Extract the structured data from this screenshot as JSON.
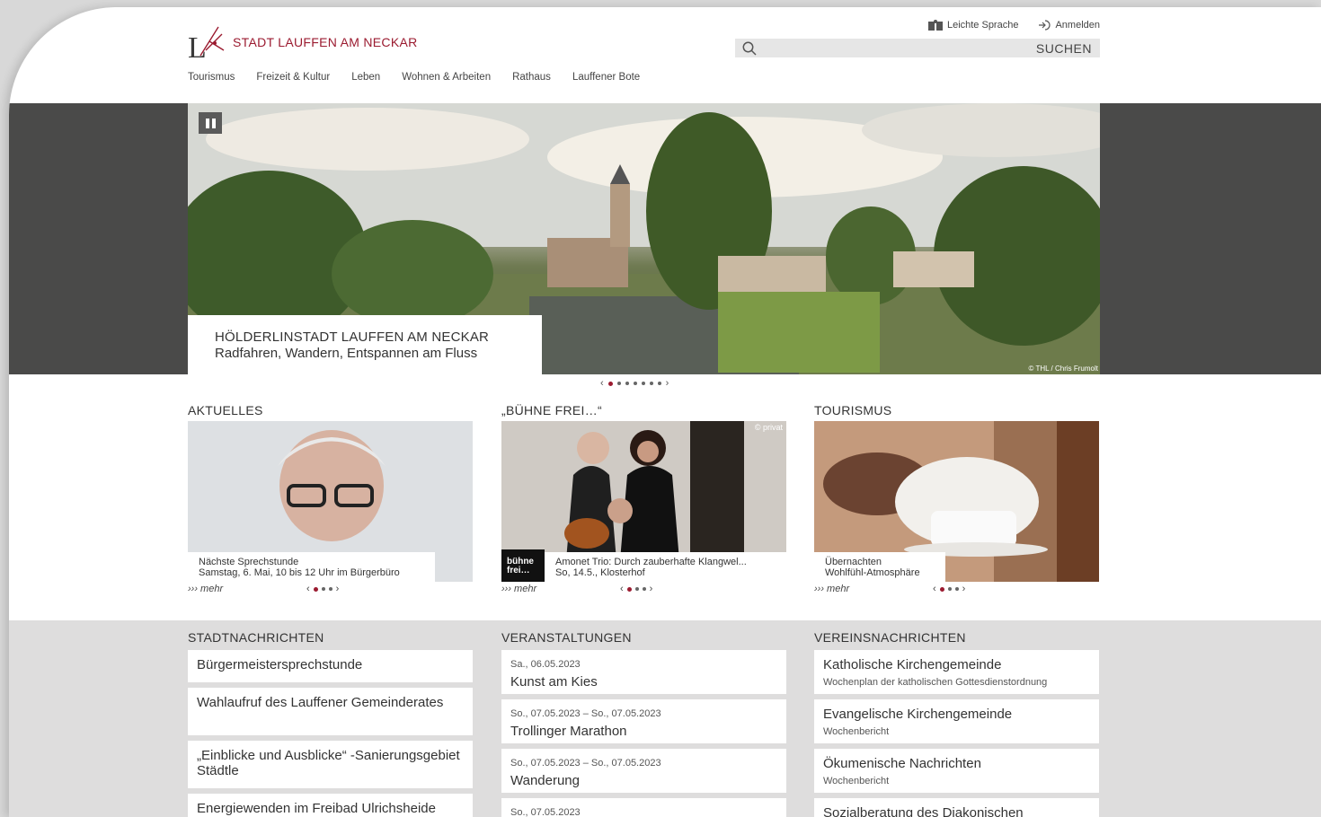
{
  "header": {
    "logo_text": "STADT LAUFFEN AM NECKAR",
    "util_links": [
      "Leichte Sprache",
      "Anmelden"
    ],
    "search_button": "SUCHEN",
    "nav": [
      "Tourismus",
      "Freizeit & Kultur",
      "Leben",
      "Wohnen & Arbeiten",
      "Rathaus",
      "Lauffener Bote"
    ]
  },
  "hero": {
    "title": "HÖLDERLINSTADT LAUFFEN AM NECKAR",
    "subtitle": "Radfahren, Wandern, Entspannen am Fluss",
    "copyright": "© THL / Chris Frumolt",
    "slide_count": 7,
    "active_slide": 1
  },
  "teasers": [
    {
      "heading": "AKTUELLES",
      "caption_line1": "Nächste Sprechstunde",
      "caption_line2": "Samstag, 6. Mai, 10 bis 12 Uhr im Bürgerbüro",
      "more": "mehr"
    },
    {
      "heading": "„BÜHNE FREI…“",
      "caption_line1": "Amonet Trio: Durch zauberhafte Klangwel...",
      "caption_line2": "So, 14.5., Klosterhof",
      "badge": "bühne frei…",
      "credit": "© privat",
      "more": "mehr"
    },
    {
      "heading": "TOURISMUS",
      "caption_line1": "Übernachten",
      "caption_line2": "Wohlfühl-Atmosphäre",
      "more": "mehr"
    }
  ],
  "stadtnachrichten": {
    "heading": "STADTNACHRICHTEN",
    "items": [
      "Bürgermeistersprechstunde",
      "Wahlaufruf des Lauffener Gemeinderates",
      "„Einblicke und Ausblicke“ -Sanierungsgebiet Städtle",
      "Energiewenden im Freibad Ulrichsheide"
    ]
  },
  "veranstaltungen": {
    "heading": "VERANSTALTUNGEN",
    "items": [
      {
        "date": "Sa., 06.05.2023",
        "title": "Kunst am Kies"
      },
      {
        "date": "So., 07.05.2023 – So., 07.05.2023",
        "title": "Trollinger Marathon"
      },
      {
        "date": "So., 07.05.2023 – So., 07.05.2023",
        "title": "Wanderung"
      },
      {
        "date": "So., 07.05.2023",
        "title": ""
      }
    ]
  },
  "vereinsnachrichten": {
    "heading": "VEREINSNACHRICHTEN",
    "items": [
      {
        "title": "Katholische Kirchengemeinde",
        "sub": "Wochenplan der katholischen Gottesdienstordnung"
      },
      {
        "title": "Evangelische Kirchengemeinde",
        "sub": "Wochenbericht"
      },
      {
        "title": "Ökumenische Nachrichten",
        "sub": "Wochenbericht"
      },
      {
        "title": "Sozialberatung des Diakonischen",
        "sub": ""
      }
    ]
  },
  "colors": {
    "brand": "#9b1b30",
    "band": "#4a4a49",
    "lower_bg": "#dedddd"
  }
}
